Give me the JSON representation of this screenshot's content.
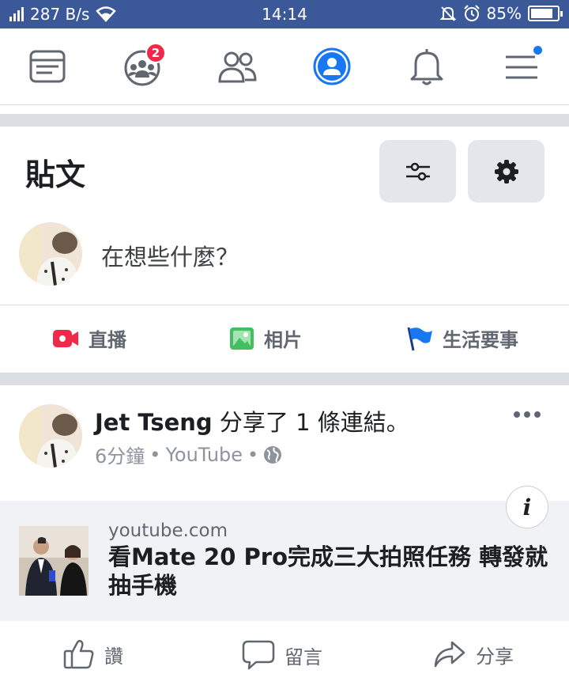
{
  "status_bar": {
    "network_speed": "287 B/s",
    "time": "14:14",
    "battery_percent": "85%",
    "battery_level": 0.85,
    "background_color": "#3b5998"
  },
  "nav": {
    "items": [
      {
        "name": "news-feed-icon",
        "active": false
      },
      {
        "name": "groups-icon",
        "badge": "2"
      },
      {
        "name": "friends-icon",
        "active": false
      },
      {
        "name": "profile-icon",
        "active": true
      },
      {
        "name": "notifications-icon",
        "active": false
      },
      {
        "name": "menu-icon",
        "has_dot": true
      }
    ],
    "active_color": "#1877f2",
    "badge_color": "#f02849"
  },
  "posts_section": {
    "title": "貼文",
    "filter_icon": "sliders-icon",
    "settings_icon": "gear-icon"
  },
  "composer": {
    "placeholder": "在想些什麼？"
  },
  "composer_actions": [
    {
      "label": "直播",
      "icon": "live-video-icon",
      "color": "#f02849"
    },
    {
      "label": "相片",
      "icon": "photo-icon",
      "color": "#45bd62"
    },
    {
      "label": "生活要事",
      "icon": "flag-icon",
      "color": "#1877f2"
    }
  ],
  "post": {
    "author": "Jet Tseng",
    "action": " 分享了 1 條連結。",
    "time": "6分鐘",
    "source": "YouTube",
    "separator": "•",
    "privacy_icon": "globe-icon",
    "link": {
      "domain": "youtube.com",
      "title": "看Mate 20 Pro完成三大拍照任務 轉發就抽手機",
      "info_label": "i"
    },
    "reactions": [
      {
        "label": "讚",
        "icon": "thumbs-up-icon"
      },
      {
        "label": "留言",
        "icon": "comment-icon"
      },
      {
        "label": "分享",
        "icon": "share-icon"
      }
    ]
  }
}
